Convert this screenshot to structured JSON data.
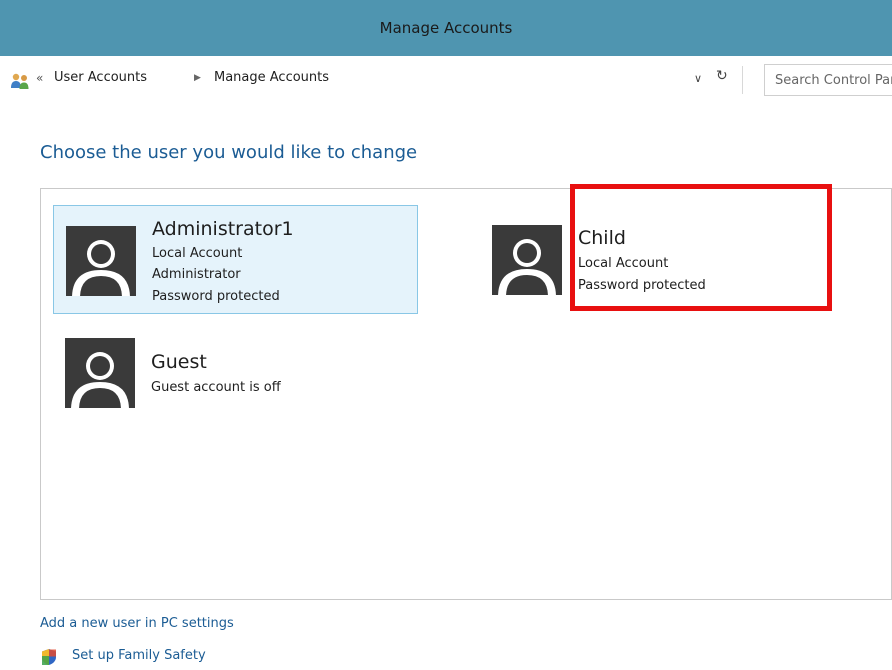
{
  "window": {
    "title": "Manage Accounts"
  },
  "address_bar": {
    "overflow_chevron": "«",
    "breadcrumbs": [
      "User Accounts",
      "Manage Accounts"
    ],
    "separator": "▶",
    "dropdown_glyph": "∨",
    "refresh_glyph": "↻",
    "search_placeholder": "Search Control Panel"
  },
  "heading": "Choose the user you would like to change",
  "accounts": [
    {
      "name": "Administrator1",
      "lines": [
        "Local Account",
        "Administrator",
        "Password protected"
      ],
      "selected": true
    },
    {
      "name": "Child",
      "lines": [
        "Local Account",
        "Password protected"
      ],
      "selected": false
    },
    {
      "name": "Guest",
      "lines": [
        "Guest account is off"
      ],
      "selected": false
    }
  ],
  "links": {
    "add_user": "Add a new user in PC settings",
    "family_safety": "Set up Family Safety"
  },
  "icons": {
    "address": "user-accounts-icon",
    "avatar": "user-avatar-icon",
    "family_safety": "shield-icon"
  },
  "colors": {
    "titlebar": "#4f95b0",
    "heading": "#1b5c94",
    "selected_bg": "#e5f3fb",
    "selected_border": "#89c7e6",
    "highlight": "#e81010"
  }
}
